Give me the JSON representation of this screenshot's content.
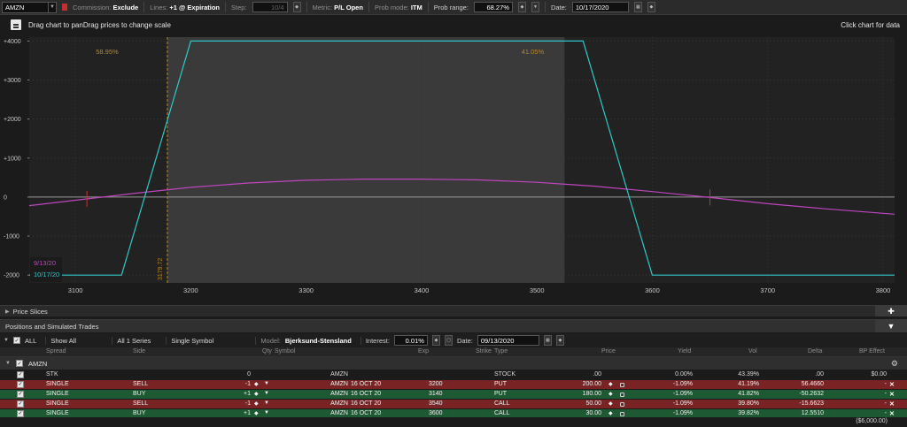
{
  "toolbar": {
    "symbol": "AMZN",
    "commission_label": "Commission:",
    "commission_value": "Exclude",
    "lines_label": "Lines:",
    "lines_value": "+1 @ Expiration",
    "step_label": "Step:",
    "step_value": "10/4",
    "metric_label": "Metric:",
    "metric_value": "P/L Open",
    "prob_mode_label": "Prob mode:",
    "prob_mode_value": "ITM",
    "prob_range_label": "Prob range:",
    "prob_range_value": "68.27%",
    "date_label": "Date:",
    "date_value": "10/17/2020"
  },
  "chart_header": {
    "message": "Drag chart to panDrag prices to change scale",
    "right_message": "Click chart for data"
  },
  "chart_data": {
    "type": "line",
    "x_ticks": [
      3100,
      3200,
      3300,
      3400,
      3500,
      3600,
      3700,
      3800
    ],
    "y_ticks": [
      "+4000",
      "+3000",
      "+2000",
      "+1000",
      "0",
      "-1000",
      "-2000"
    ],
    "xlim": [
      3060,
      3810
    ],
    "ylim": [
      -2200,
      4100
    ],
    "prob_left_label": "58.95%",
    "prob_right_label": "41.05%",
    "price_marker_label": "3179.72",
    "price_marker_x": 3179.72,
    "prob_range_x": [
      3179.72,
      3524
    ],
    "series": [
      {
        "name": "9/13/20",
        "color": "#c045c0",
        "x": [
          3060,
          3100,
          3150,
          3200,
          3250,
          3300,
          3350,
          3400,
          3450,
          3500,
          3550,
          3600,
          3650,
          3700,
          3750,
          3810
        ],
        "y": [
          -220,
          -80,
          90,
          250,
          360,
          430,
          460,
          460,
          440,
          380,
          280,
          140,
          -10,
          -170,
          -300,
          -440
        ]
      },
      {
        "name": "10/17/20",
        "color": "#2fc8c8",
        "x": [
          3060,
          3140,
          3200,
          3540,
          3600,
          3810
        ],
        "y": [
          -2000,
          -2000,
          4000,
          4000,
          -2000,
          -2000
        ]
      }
    ],
    "markers": [
      3110,
      3650
    ]
  },
  "panels": {
    "price_slices": "Price Slices",
    "positions": "Positions and Simulated Trades"
  },
  "options": {
    "all_label": "ALL",
    "show_all": "Show All",
    "series": "All 1 Series",
    "single_symbol": "Single Symbol",
    "model_label": "Model:",
    "model_value": "Bjerksund-Stensland",
    "interest_label": "Interest:",
    "interest_value": "0.01%",
    "date_label": "Date:",
    "date_value": "09/13/2020"
  },
  "columns": {
    "spread": "Spread",
    "side": "Side",
    "qty": "Qty",
    "symbol": "Symbol",
    "exp": "Exp",
    "strike": "Strike",
    "type": "Type",
    "price": "Price",
    "yield": "Yield",
    "vol": "Vol",
    "delta": "Delta",
    "bp_effect": "BP Effect"
  },
  "group": {
    "name": "AMZN"
  },
  "rows": [
    {
      "spread": "STK",
      "side": "",
      "qty": "0",
      "symbol": "AMZN",
      "exp": "",
      "strike": "",
      "type": "STOCK",
      "price": ".00",
      "yield": "0.00%",
      "vol": "43.39%",
      "delta": ".00",
      "bp": "$0.00"
    },
    {
      "spread": "SINGLE",
      "side": "SELL",
      "qty": "-1",
      "symbol": "AMZN",
      "exp": "16 OCT 20",
      "strike": "3200",
      "type": "PUT",
      "price": "200.00",
      "yield": "-1.09%",
      "vol": "41.19%",
      "delta": "56.4660",
      "bp": "-"
    },
    {
      "spread": "SINGLE",
      "side": "BUY",
      "qty": "+1",
      "symbol": "AMZN",
      "exp": "16 OCT 20",
      "strike": "3140",
      "type": "PUT",
      "price": "180.00",
      "yield": "-1.09%",
      "vol": "41.82%",
      "delta": "-50.2632",
      "bp": "-"
    },
    {
      "spread": "SINGLE",
      "side": "SELL",
      "qty": "-1",
      "symbol": "AMZN",
      "exp": "16 OCT 20",
      "strike": "3540",
      "type": "CALL",
      "price": "50.00",
      "yield": "-1.09%",
      "vol": "39.80%",
      "delta": "-15.6623",
      "bp": "-"
    },
    {
      "spread": "SINGLE",
      "side": "BUY",
      "qty": "+1",
      "symbol": "AMZN",
      "exp": "16 OCT 20",
      "strike": "3600",
      "type": "CALL",
      "price": "30.00",
      "yield": "-1.09%",
      "vol": "39.82%",
      "delta": "12.5510",
      "bp": "-"
    }
  ],
  "total_bp": "($6,000.00)"
}
